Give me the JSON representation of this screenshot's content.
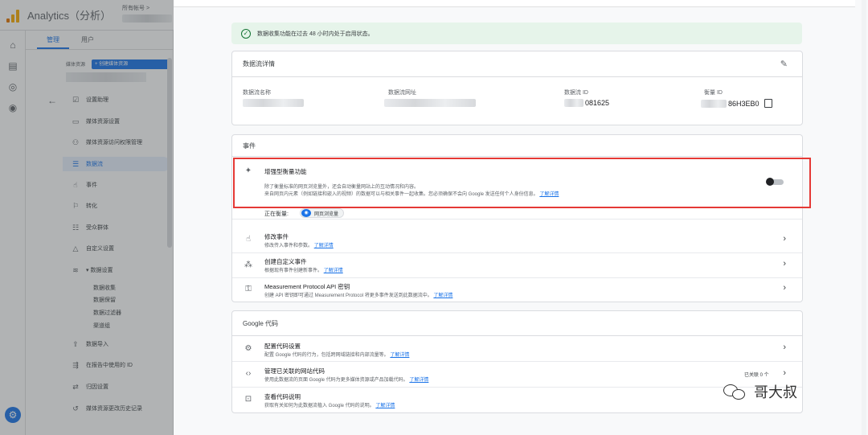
{
  "app": {
    "title": "Analytics（分析）",
    "account_label": "所有帐号 >"
  },
  "admin": {
    "tabs": [
      "管理",
      "用户"
    ],
    "property_label": "媒体资源",
    "create_button": "+ 创建媒体资源",
    "nav": [
      {
        "label": "设置助理",
        "icon": "checklist-icon"
      },
      {
        "label": "媒体资源设置",
        "icon": "property-icon"
      },
      {
        "label": "媒体资源访问权限管理",
        "icon": "people-icon"
      },
      {
        "label": "数据流",
        "icon": "streams-icon",
        "active": true
      },
      {
        "label": "事件",
        "icon": "event-icon"
      },
      {
        "label": "转化",
        "icon": "flag-icon"
      },
      {
        "label": "受众群体",
        "icon": "audience-icon"
      },
      {
        "label": "自定义设置",
        "icon": "shapes-icon"
      },
      {
        "label": "▾ 数据设置",
        "icon": "database-icon"
      }
    ],
    "sub_nav": [
      "数据收集",
      "数据保留",
      "数据过滤器",
      "渠道组"
    ],
    "nav2": [
      {
        "label": "数据导入",
        "icon": "upload-icon"
      },
      {
        "label": "在报告中使用的 ID",
        "icon": "id-icon"
      },
      {
        "label": "归因设置",
        "icon": "attribution-icon"
      },
      {
        "label": "媒体资源更改历史记录",
        "icon": "history-icon"
      }
    ]
  },
  "banner": {
    "text": "数据收集功能在过去 48 小时内处于启用状态。"
  },
  "stream_details": {
    "heading": "数据流详情",
    "name_label": "数据流名称",
    "url_label": "数据流网址",
    "id_label": "数据流 ID",
    "id_value": "081625",
    "measurement_label": "衡量 ID",
    "measurement_value": "86H3EB0"
  },
  "events": {
    "heading": "事件",
    "enhanced": {
      "title": "增强型衡量功能",
      "desc1": "除了衡量标准的网页浏览量外，还会自动衡量网站上的互动情况和内容。",
      "desc2": "来自网页内元素（例如链接和嵌入的视频）的数据可以与相关事件一起收集。您必须确保不会向 Google 发送任何个人身份信息。",
      "link": "了解详情",
      "measuring_label": "正在衡量:",
      "chip": "网页浏览量"
    },
    "rows": [
      {
        "title": "修改事件",
        "desc": "修改传入事件和参数。",
        "link": "了解详情"
      },
      {
        "title": "创建自定义事件",
        "desc": "根据现有事件创建新事件。",
        "link": "了解详情"
      },
      {
        "title": "Measurement Protocol API 密钥",
        "desc": "创建 API 密钥即可通过 Measurement Protocol 将更多事件发送到此数据流中。",
        "link": "了解详情"
      }
    ]
  },
  "google_tag": {
    "heading": "Google 代码",
    "rows": [
      {
        "title": "配置代码设置",
        "desc": "配置 Google 代码的行为，包括跨网域链接和内部流量等。",
        "link": "了解详情"
      },
      {
        "title": "管理已关联的网站代码",
        "desc": "使用此数据流的页面 Google 代码为更多媒体资源或产品加载代码。",
        "link": "了解详情",
        "badge": "已关联 0 个"
      },
      {
        "title": "查看代码说明",
        "desc": "获取有关如何为此数据流植入 Google 代码的说明。",
        "link": "了解详情"
      }
    ]
  },
  "watermark": {
    "text": "哥大叔"
  },
  "colors": {
    "accent": "#1a73e8",
    "success": "#137333",
    "highlight_box": "#e53935"
  }
}
